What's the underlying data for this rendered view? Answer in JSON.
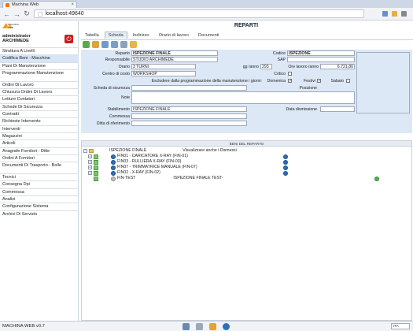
{
  "browser": {
    "tab_title": "Machina Web",
    "url": "localhost:49640"
  },
  "app": {
    "logo_text": "MACHINA WEB",
    "user_role": "administrator",
    "user_name": "ARCHIMEDE",
    "version": "MACHINA WEB v0.7",
    "language": "ITA"
  },
  "menu": [
    {
      "label": "Struttura A Livelli"
    },
    {
      "label": "Codifica Beni - Macchine"
    },
    {
      "label": "Piani Di Manutenzione"
    },
    {
      "label": "Programmazione Manutenzione"
    },
    {
      "label": "Ordini Di Lavoro"
    },
    {
      "label": "Chiusura Ordini Di Lavoro"
    },
    {
      "label": "Letture Contatori"
    },
    {
      "label": "Schede Di Sicurezza"
    },
    {
      "label": "Contratti"
    },
    {
      "label": "Richieste Intervento"
    },
    {
      "label": "Interventi"
    },
    {
      "label": "Magazzini"
    },
    {
      "label": "Articoli"
    },
    {
      "label": "Anagrafe Fornitori - Ditte"
    },
    {
      "label": "Ordini A Fornitori"
    },
    {
      "label": "Documenti Di Trasporto - Bolle"
    },
    {
      "label": "Tecnici"
    },
    {
      "label": "Consegna Dpi"
    },
    {
      "label": "Commessa"
    },
    {
      "label": "Analisi"
    },
    {
      "label": "Configurazione Sistema"
    },
    {
      "label": "Archivi Di Servizio"
    }
  ],
  "page": {
    "title": "REPARTI",
    "tabs": [
      "Tabella",
      "Scheda",
      "Indirizzo",
      "Orario di lavoro",
      "Documenti"
    ]
  },
  "form": {
    "reparto_label": "Reparto",
    "reparto_value": "ISPEZIONE FINALE",
    "codice_label": "Codice",
    "codice_value": "ISPEZIONE",
    "responsabile_label": "Responsabile",
    "responsabile_value": "STUDIO ARCHIMEDE",
    "sap_label": "SAP",
    "sap_value": "",
    "orario_label": "Orario",
    "orario_value": "3 TURNI",
    "gg_label": "gg /anno",
    "gg_value": "293",
    "ore_label": "Ore lavoro /anno",
    "ore_value": "6.721,80",
    "centro_label": "Centro di costo",
    "centro_value": "WORKSHOP",
    "critico_label": "Critico",
    "escludere_label": "Escludere dalla programmazione della manutenzione i giorni:",
    "domenica_label": "Domenica",
    "festivi_label": "Festivi",
    "sabato_label": "Sabato",
    "scheda_label": "Scheda di sicurezza",
    "scheda_value": "",
    "posizione_label": "Posizione",
    "posizione_value": "",
    "note_label": "Note",
    "note_value": "",
    "stabilimento_label": "Stabilimento",
    "stabilimento_value": "ISPEZIONE FINALE",
    "dismissione_label": "Data dismissione",
    "dismissione_value": "",
    "commessa_label": "Commessa",
    "commessa_value": "",
    "ditta_label": "Ditta di riferimento",
    "ditta_value": ""
  },
  "tree": {
    "header": "BENI DEL REPARTO",
    "root": "ISPEZIONE FINALE",
    "root_note": "Visualizzare anche i Dismessi",
    "items": [
      {
        "label": "FIN01 - CARICATORE X-RAY (FIN-01)"
      },
      {
        "label": "FIN03 - RULLIERA X-RAY (FIN-03)"
      },
      {
        "label": "FIN07 - TRIMMATRICE MANUALE (FIN-07)"
      },
      {
        "label": "FIN02 - X-RAY (FIN-02)"
      }
    ],
    "test_label": "FIN-TEST",
    "test_desc": "ISPEZIONE FINALE TEST-"
  }
}
